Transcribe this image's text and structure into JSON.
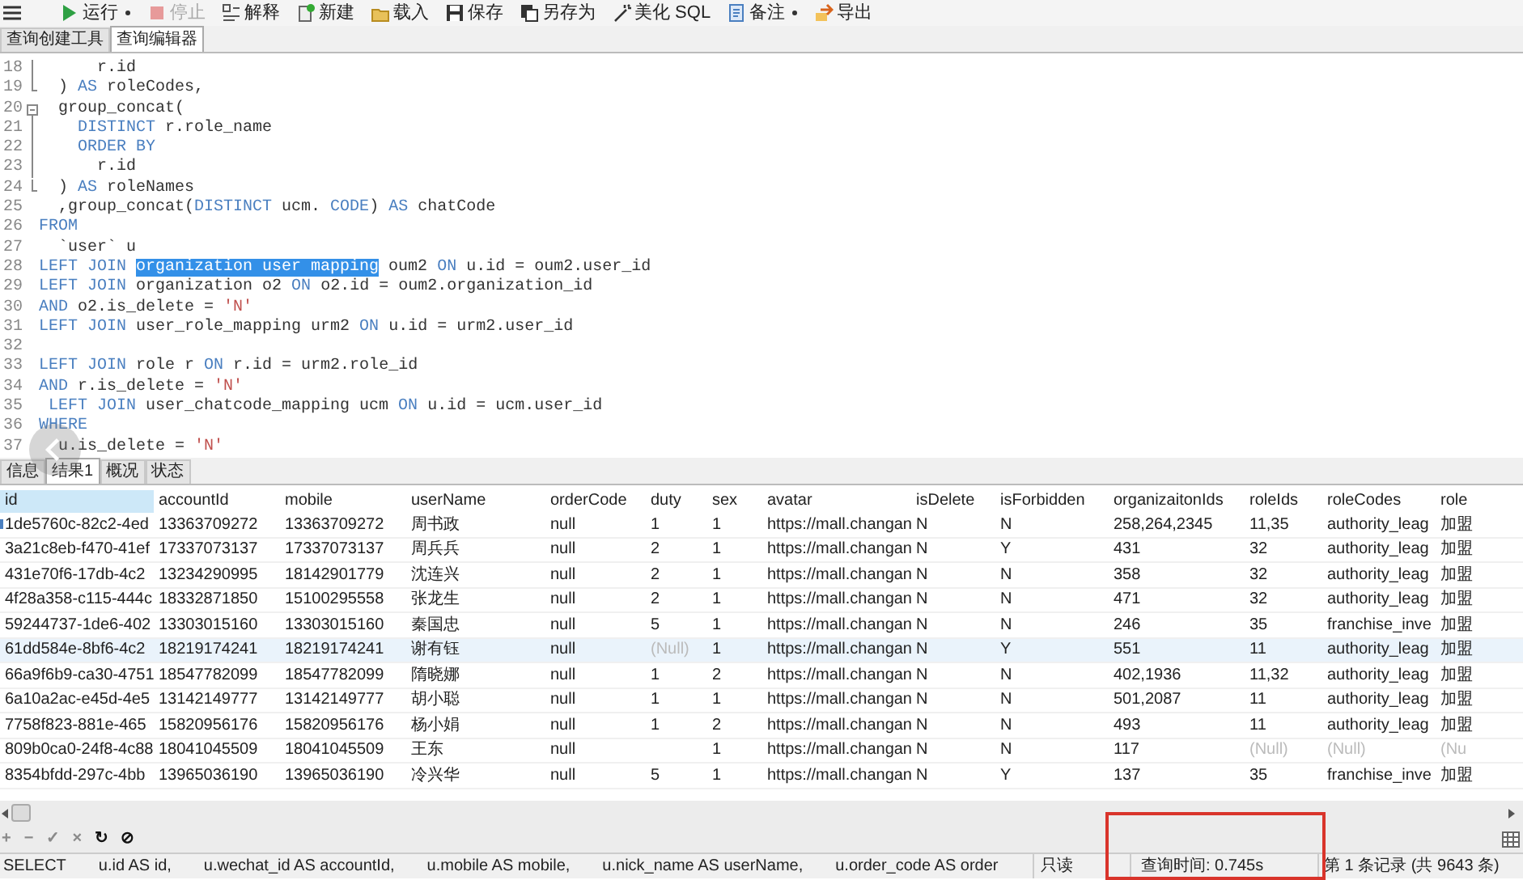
{
  "toolbar": [
    {
      "label": "运行",
      "kind": "run",
      "dropdown": true,
      "disabled": false
    },
    {
      "label": "停止",
      "kind": "stop",
      "dropdown": false,
      "disabled": true
    },
    {
      "label": "解释",
      "kind": "explain",
      "dropdown": false,
      "disabled": false
    },
    {
      "label": "新建",
      "kind": "new",
      "dropdown": false,
      "disabled": false
    },
    {
      "label": "载入",
      "kind": "load",
      "dropdown": false,
      "disabled": false
    },
    {
      "label": "保存",
      "kind": "save",
      "dropdown": false,
      "disabled": false
    },
    {
      "label": "另存为",
      "kind": "saveas",
      "dropdown": false,
      "disabled": false
    },
    {
      "label": "美化 SQL",
      "kind": "beautify",
      "dropdown": false,
      "disabled": false
    },
    {
      "label": "备注",
      "kind": "comment",
      "dropdown": true,
      "disabled": false
    },
    {
      "label": "导出",
      "kind": "export",
      "dropdown": false,
      "disabled": false
    }
  ],
  "editor_tabs": [
    {
      "label": "查询创建工具",
      "selected": false
    },
    {
      "label": "查询编辑器",
      "selected": true
    }
  ],
  "editor": {
    "lines": [
      {
        "number": "18",
        "kind": "foldmid",
        "tokens": [
          {
            "t": "      r.id",
            "kind": "plain"
          }
        ]
      },
      {
        "number": "19",
        "kind": "foldend",
        "tokens": [
          {
            "t": "  ) ",
            "kind": "plain"
          },
          {
            "t": "AS",
            "kind": "keyword"
          },
          {
            "t": " roleCodes,",
            "kind": "plain"
          }
        ]
      },
      {
        "number": "20",
        "kind": "foldstart",
        "tokens": [
          {
            "t": "  group_concat(",
            "kind": "plain"
          }
        ]
      },
      {
        "number": "21",
        "kind": "foldmid",
        "tokens": [
          {
            "t": "    DISTINCT",
            "kind": "keyword"
          },
          {
            "t": " r.role_name",
            "kind": "plain"
          }
        ]
      },
      {
        "number": "22",
        "kind": "foldmid",
        "tokens": [
          {
            "t": "    ORDER BY",
            "kind": "keyword"
          }
        ]
      },
      {
        "number": "23",
        "kind": "foldmid",
        "tokens": [
          {
            "t": "      r.id",
            "kind": "plain"
          }
        ]
      },
      {
        "number": "24",
        "kind": "foldend",
        "tokens": [
          {
            "t": "  ) ",
            "kind": "plain"
          },
          {
            "t": "AS",
            "kind": "keyword"
          },
          {
            "t": " roleNames",
            "kind": "plain"
          }
        ]
      },
      {
        "number": "25",
        "kind": "code",
        "tokens": [
          {
            "t": "  ,group_concat(",
            "kind": "plain"
          },
          {
            "t": "DISTINCT",
            "kind": "keyword"
          },
          {
            "t": " ucm. ",
            "kind": "plain"
          },
          {
            "t": "CODE",
            "kind": "keyword"
          },
          {
            "t": ") ",
            "kind": "plain"
          },
          {
            "t": "AS",
            "kind": "keyword"
          },
          {
            "t": " chatCode",
            "kind": "plain"
          }
        ]
      },
      {
        "number": "26",
        "kind": "code",
        "tokens": [
          {
            "t": "FROM",
            "kind": "keyword"
          }
        ]
      },
      {
        "number": "27",
        "kind": "code",
        "tokens": [
          {
            "t": "  `user` u",
            "kind": "plain"
          }
        ]
      },
      {
        "number": "28",
        "kind": "code",
        "tokens": [
          {
            "t": "LEFT JOIN ",
            "kind": "keyword"
          },
          {
            "t": "organization user mapping",
            "kind": "selection"
          },
          {
            "t": " oum2 ",
            "kind": "plain"
          },
          {
            "t": "ON",
            "kind": "keyword"
          },
          {
            "t": " u.id = oum2.user_id",
            "kind": "plain"
          }
        ]
      },
      {
        "number": "29",
        "kind": "code",
        "tokens": [
          {
            "t": "LEFT JOIN",
            "kind": "keyword"
          },
          {
            "t": " organization o2 ",
            "kind": "plain"
          },
          {
            "t": "ON",
            "kind": "keyword"
          },
          {
            "t": " o2.id = oum2.organization_id",
            "kind": "plain"
          }
        ]
      },
      {
        "number": "30",
        "kind": "code",
        "tokens": [
          {
            "t": "AND",
            "kind": "keyword"
          },
          {
            "t": " o2.is_delete = ",
            "kind": "plain"
          },
          {
            "t": "'N'",
            "kind": "string"
          }
        ]
      },
      {
        "number": "31",
        "kind": "code",
        "tokens": [
          {
            "t": "LEFT JOIN",
            "kind": "keyword"
          },
          {
            "t": " user_role_mapping urm2 ",
            "kind": "plain"
          },
          {
            "t": "ON",
            "kind": "keyword"
          },
          {
            "t": " u.id = urm2.user_id",
            "kind": "plain"
          }
        ]
      },
      {
        "number": "32",
        "kind": "code"
      },
      {
        "number": "33",
        "kind": "code",
        "tokens": [
          {
            "t": "LEFT JOIN",
            "kind": "keyword"
          },
          {
            "t": " role r ",
            "kind": "plain"
          },
          {
            "t": "ON",
            "kind": "keyword"
          },
          {
            "t": " r.id = urm2.role_id",
            "kind": "plain"
          }
        ]
      },
      {
        "number": "34",
        "kind": "code",
        "tokens": [
          {
            "t": "AND",
            "kind": "keyword"
          },
          {
            "t": " r.is_delete = ",
            "kind": "plain"
          },
          {
            "t": "'N'",
            "kind": "string"
          }
        ]
      },
      {
        "number": "35",
        "kind": "code",
        "tokens": [
          {
            "t": " LEFT JOIN",
            "kind": "keyword"
          },
          {
            "t": " user_chatcode_mapping ucm ",
            "kind": "plain"
          },
          {
            "t": "ON",
            "kind": "keyword"
          },
          {
            "t": " u.id = ucm.user_id",
            "kind": "plain"
          }
        ]
      },
      {
        "number": "36",
        "kind": "code",
        "tokens": [
          {
            "t": "WHERE",
            "kind": "keyword"
          }
        ]
      },
      {
        "number": "37",
        "kind": "code",
        "tokens": [
          {
            "t": "  u.is_delete = ",
            "kind": "plain"
          },
          {
            "t": "'N'",
            "kind": "string"
          }
        ]
      }
    ]
  },
  "result_tabs": [
    {
      "label": "信息",
      "selected": false
    },
    {
      "label": "结果1",
      "selected": true
    },
    {
      "label": "概况",
      "selected": false
    },
    {
      "label": "状态",
      "selected": false
    }
  ],
  "table": {
    "columns": [
      {
        "label": "id",
        "selected": true
      },
      {
        "label": "accountId",
        "selected": false
      },
      {
        "label": "mobile",
        "selected": false
      },
      {
        "label": "userName",
        "selected": false
      },
      {
        "label": "orderCode",
        "selected": false
      },
      {
        "label": "duty",
        "selected": false
      },
      {
        "label": "sex",
        "selected": false
      },
      {
        "label": "avatar",
        "selected": false
      },
      {
        "label": "isDelete",
        "selected": false
      },
      {
        "label": "isForbidden",
        "selected": false
      },
      {
        "label": "organizaitonIds",
        "selected": false
      },
      {
        "label": "roleIds",
        "selected": false
      },
      {
        "label": "roleCodes",
        "selected": false
      },
      {
        "label": "role",
        "selected": false
      }
    ],
    "rows": [
      {
        "current": true,
        "selected": false,
        "cells": [
          "1de5760c-82c2-4ed",
          "13363709272",
          "13363709272",
          "周书政",
          "null",
          "1",
          "1",
          "https://mall.changan",
          "N",
          "N",
          "258,264,2345",
          "11,35",
          "authority_leag",
          "加盟"
        ]
      },
      {
        "current": false,
        "selected": false,
        "cells": [
          "3a21c8eb-f470-41ef",
          "17337073137",
          "17337073137",
          "周兵兵",
          "null",
          "2",
          "1",
          "https://mall.changan",
          "N",
          "Y",
          "431",
          "32",
          "authority_leag",
          "加盟"
        ]
      },
      {
        "current": false,
        "selected": false,
        "cells": [
          "431e70f6-17db-4c2",
          "13234290995",
          "18142901779",
          "沈连兴",
          "null",
          "2",
          "1",
          "https://mall.changan",
          "N",
          "N",
          "358",
          "32",
          "authority_leag",
          "加盟"
        ]
      },
      {
        "current": false,
        "selected": false,
        "cells": [
          "4f28a358-c115-444c",
          "18332871850",
          "15100295558",
          "张龙生",
          "null",
          "2",
          "1",
          "https://mall.changan",
          "N",
          "N",
          "471",
          "32",
          "authority_leag",
          "加盟"
        ]
      },
      {
        "current": false,
        "selected": false,
        "cells": [
          "59244737-1de6-402",
          "13303015160",
          "13303015160",
          "秦国忠",
          "null",
          "5",
          "1",
          "https://mall.changan",
          "N",
          "N",
          "246",
          "35",
          "franchise_inve",
          "加盟"
        ]
      },
      {
        "current": false,
        "selected": true,
        "cells": [
          "61dd584e-8bf6-4c2",
          "18219174241",
          "18219174241",
          "谢有钰",
          "null",
          {
            "text": "(Null)",
            "null": true
          },
          "1",
          "https://mall.changan",
          "N",
          "Y",
          "551",
          "11",
          "authority_leag",
          "加盟"
        ]
      },
      {
        "current": false,
        "selected": false,
        "cells": [
          "66a9f6b9-ca30-4751",
          "18547782099",
          "18547782099",
          "隋晓娜",
          "null",
          "1",
          "2",
          "https://mall.changan",
          "N",
          "N",
          "402,1936",
          "11,32",
          "authority_leag",
          "加盟"
        ]
      },
      {
        "current": false,
        "selected": false,
        "cells": [
          "6a10a2ac-e45d-4e5",
          "13142149777",
          "13142149777",
          "胡小聪",
          "null",
          "1",
          "1",
          "https://mall.changan",
          "N",
          "N",
          "501,2087",
          "11",
          "authority_leag",
          "加盟"
        ]
      },
      {
        "current": false,
        "selected": false,
        "cells": [
          "7758f823-881e-465",
          "15820956176",
          "15820956176",
          "杨小娟",
          "null",
          "1",
          "2",
          "https://mall.changan",
          "N",
          "N",
          "493",
          "11",
          "authority_leag",
          "加盟"
        ]
      },
      {
        "current": false,
        "selected": false,
        "cells": [
          "809b0ca0-24f8-4c88",
          "18041045509",
          "18041045509",
          "王东",
          "null",
          "",
          "1",
          "https://mall.changan",
          "N",
          "N",
          "117",
          {
            "text": "(Null)",
            "null": true
          },
          {
            "text": "(Null)",
            "null": true
          },
          {
            "text": "(Nu",
            "null": true
          }
        ]
      },
      {
        "current": false,
        "selected": false,
        "cells": [
          "8354bfdd-297c-4bb",
          "13965036190",
          "13965036190",
          "冷兴华",
          "null",
          "5",
          "1",
          "https://mall.changan",
          "N",
          "Y",
          "137",
          "35",
          "franchise_inve",
          "加盟"
        ]
      }
    ]
  },
  "grid_tools": [
    {
      "label": "+",
      "disabled": true
    },
    {
      "label": "−",
      "disabled": true
    },
    {
      "label": "✓",
      "disabled": true
    },
    {
      "label": "×",
      "disabled": true
    },
    {
      "label": "↻",
      "disabled": false
    },
    {
      "label": "⊘",
      "disabled": false
    }
  ],
  "status_bar": {
    "query_parts": [
      "SELECT",
      "u.id AS id,",
      "u.wechat_id AS accountId,",
      "u.mobile AS mobile,",
      "u.nick_name AS userName,",
      "u.order_code AS order"
    ],
    "mode": "只读",
    "query_time": "查询时间: 0.745s",
    "record": "第 1 条记录 (共 9643 条)",
    "highlighted": true
  }
}
